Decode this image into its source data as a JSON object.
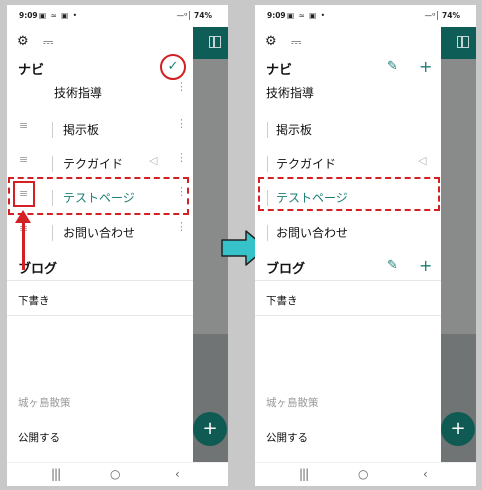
{
  "status": {
    "time": "9:09",
    "icons": "▣ ≈ ▣ •",
    "signal": "—ᵅ│",
    "battery": "74%"
  },
  "toolbar": {
    "gear_icon": "⚙",
    "pulse_icon": "⎓"
  },
  "nav": {
    "header": "ナビ",
    "done_icon": "✓",
    "edit_icon": "✎",
    "add_icon": "+"
  },
  "nav_items": [
    {
      "label": "技術指導"
    },
    {
      "label": "掲示板"
    },
    {
      "label": "テクガイド"
    },
    {
      "label": "テストページ"
    },
    {
      "label": "お問い合わせ"
    }
  ],
  "drag_icon": "≡",
  "kebab_icon": "⋮",
  "megaphone_icon": "◁",
  "blog": {
    "header": "ブログ",
    "drafts": "下書き",
    "edit_icon": "✎",
    "add_icon": "+"
  },
  "site": {
    "name": "城ヶ島散策",
    "publish": "公開する"
  },
  "fab_icon": "+",
  "navbar": {
    "recents_icon": "|||",
    "home_icon": "○",
    "back_icon": "‹"
  },
  "colors": {
    "teal": "#1a7f74",
    "red_annotation": "#d41f23",
    "arrow_cyan": "#35c2c9"
  }
}
